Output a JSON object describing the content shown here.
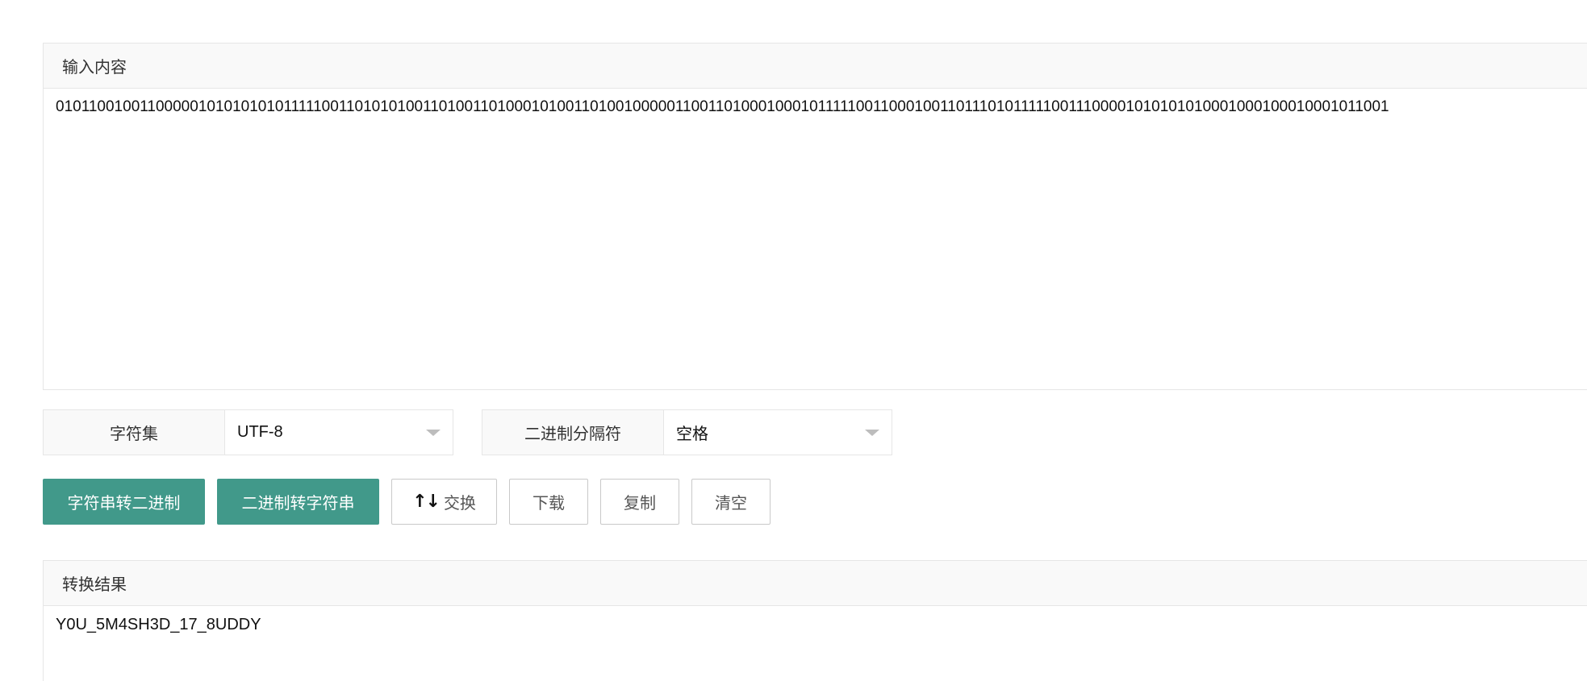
{
  "input": {
    "header": "输入内容",
    "value": "0101100100110000010101010101111100110101010011010011010001010011010010000011001101000100010111110011000100110111010111110011100001010101010001000100010001011001"
  },
  "charset": {
    "label": "字符集",
    "selected": "UTF-8"
  },
  "separator": {
    "label": "二进制分隔符",
    "selected": "空格"
  },
  "buttons": {
    "str2bin": "字符串转二进制",
    "bin2str": "二进制转字符串",
    "swap_icon": "↑↓",
    "swap": "交换",
    "download": "下载",
    "copy": "复制",
    "clear": "清空"
  },
  "result": {
    "header": "转换结果",
    "value": "Y0U_5M4SH3D_17_8UDDY"
  },
  "colors": {
    "primary": "#41998a",
    "header_bg": "#f9f9f9",
    "border": "#e6e6e6"
  }
}
